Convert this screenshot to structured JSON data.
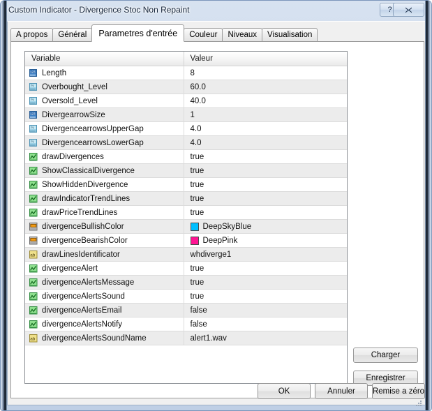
{
  "window": {
    "title": "Custom Indicator - Divergence Stoc Non Repaint",
    "help_label": "?",
    "close_label": "✕"
  },
  "tabs": [
    {
      "label": "A propos",
      "active": false
    },
    {
      "label": "Général",
      "active": false
    },
    {
      "label": "Parametres d'entrée",
      "active": true
    },
    {
      "label": "Couleur",
      "active": false
    },
    {
      "label": "Niveaux",
      "active": false
    },
    {
      "label": "Visualisation",
      "active": false
    }
  ],
  "grid": {
    "headers": {
      "variable": "Variable",
      "valeur": "Valeur"
    },
    "rows": [
      {
        "icon": "integer-icon",
        "name": "Length",
        "value": "8"
      },
      {
        "icon": "double-icon",
        "name": "Overbought_Level",
        "value": "60.0"
      },
      {
        "icon": "double-icon",
        "name": "Oversold_Level",
        "value": "40.0"
      },
      {
        "icon": "integer-icon",
        "name": "DivergearrowSize",
        "value": "1"
      },
      {
        "icon": "double-icon",
        "name": "DivergencearrowsUpperGap",
        "value": "4.0"
      },
      {
        "icon": "double-icon",
        "name": "DivergencearrowsLowerGap",
        "value": "4.0"
      },
      {
        "icon": "boolean-icon",
        "name": "drawDivergences",
        "value": "true"
      },
      {
        "icon": "boolean-icon",
        "name": "ShowClassicalDivergence",
        "value": "true"
      },
      {
        "icon": "boolean-icon",
        "name": "ShowHiddenDivergence",
        "value": "true"
      },
      {
        "icon": "boolean-icon",
        "name": "drawIndicatorTrendLines",
        "value": "true"
      },
      {
        "icon": "boolean-icon",
        "name": "drawPriceTrendLines",
        "value": "true"
      },
      {
        "icon": "color-icon",
        "name": "divergenceBullishColor",
        "value": "DeepSkyBlue",
        "swatch": "#00BFFF"
      },
      {
        "icon": "color-icon",
        "name": "divergenceBearishColor",
        "value": "DeepPink",
        "swatch": "#FF1493"
      },
      {
        "icon": "string-icon",
        "name": "drawLinesIdentificator",
        "value": "whdiverge1"
      },
      {
        "icon": "boolean-icon",
        "name": "divergenceAlert",
        "value": "true"
      },
      {
        "icon": "boolean-icon",
        "name": "divergenceAlertsMessage",
        "value": "true"
      },
      {
        "icon": "boolean-icon",
        "name": "divergenceAlertsSound",
        "value": "true"
      },
      {
        "icon": "boolean-icon",
        "name": "divergenceAlertsEmail",
        "value": "false"
      },
      {
        "icon": "boolean-icon",
        "name": "divergenceAlertsNotify",
        "value": "false"
      },
      {
        "icon": "string-icon",
        "name": "divergenceAlertsSoundName",
        "value": "alert1.wav"
      }
    ]
  },
  "side_buttons": {
    "charger": "Charger",
    "enregistrer": "Enregistrer"
  },
  "bottom_buttons": {
    "ok": "OK",
    "annuler": "Annuler",
    "reset": "Remise a zéro"
  }
}
